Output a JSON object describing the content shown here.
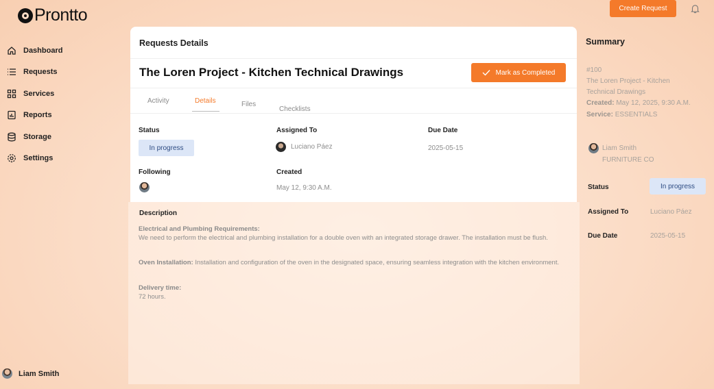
{
  "brand": {
    "name": "Prontto"
  },
  "sidebar": {
    "items": [
      {
        "label": "Dashboard",
        "icon": "home-icon"
      },
      {
        "label": "Requests",
        "icon": "list-icon"
      },
      {
        "label": "Services",
        "icon": "grid-icon"
      },
      {
        "label": "Reports",
        "icon": "report-icon"
      },
      {
        "label": "Storage",
        "icon": "database-icon"
      },
      {
        "label": "Settings",
        "icon": "gear-icon"
      }
    ],
    "user": {
      "name": "Liam Smith"
    }
  },
  "header": {
    "create_label": "Create Request",
    "bell_icon": "bell-icon"
  },
  "main": {
    "card_title": "Requests Details",
    "project_title": "The Loren Project - Kitchen Technical Drawings",
    "complete_label": "Mark as Completed",
    "tabs": [
      {
        "label": "Activity"
      },
      {
        "label": "Details",
        "active": true
      },
      {
        "label": "Files"
      },
      {
        "label": "Checklists"
      }
    ],
    "fields": {
      "status_label": "Status",
      "status_value": "In progress",
      "assigned_label": "Assigned To",
      "assigned_value": "Luciano Páez",
      "due_label": "Due Date",
      "due_value": "2025-05-15",
      "following_label": "Following",
      "created_label": "Created",
      "created_value": "May 12, 9:30 A.M."
    },
    "description": {
      "title": "Description",
      "p1_heading": "Electrical and Plumbing Requirements:",
      "p1_text": "We need to perform the electrical and plumbing installation for a double oven with an integrated storage drawer. The installation must be flush.",
      "p2_heading": "Oven Installation:",
      "p2_text": " Installation and configuration of the oven in the designated space, ensuring seamless integration with the kitchen environment.",
      "p3_heading": "Delivery time:",
      "p3_text": "72 hours."
    }
  },
  "summary": {
    "title": "Summary",
    "id": "#100",
    "project_line1": "The Loren Project - Kitchen",
    "project_line2": "Technical Drawings",
    "created_label": "Created:",
    "created_value": " May 12, 2025, 9:30 A.M.",
    "service_label": "Service:",
    "service_value": " ESSENTIALS",
    "client_name": "Liam Smith",
    "client_company": "FURNITURE CO",
    "status_label": "Status",
    "status_value": "In progress",
    "assigned_label": "Assigned To",
    "assigned_value": "Luciano Páez",
    "due_label": "Due Date",
    "due_value": "2025-05-15"
  },
  "colors": {
    "accent": "#f47a2a",
    "status_bg": "#dce6f7",
    "status_text": "#2d4b82"
  }
}
